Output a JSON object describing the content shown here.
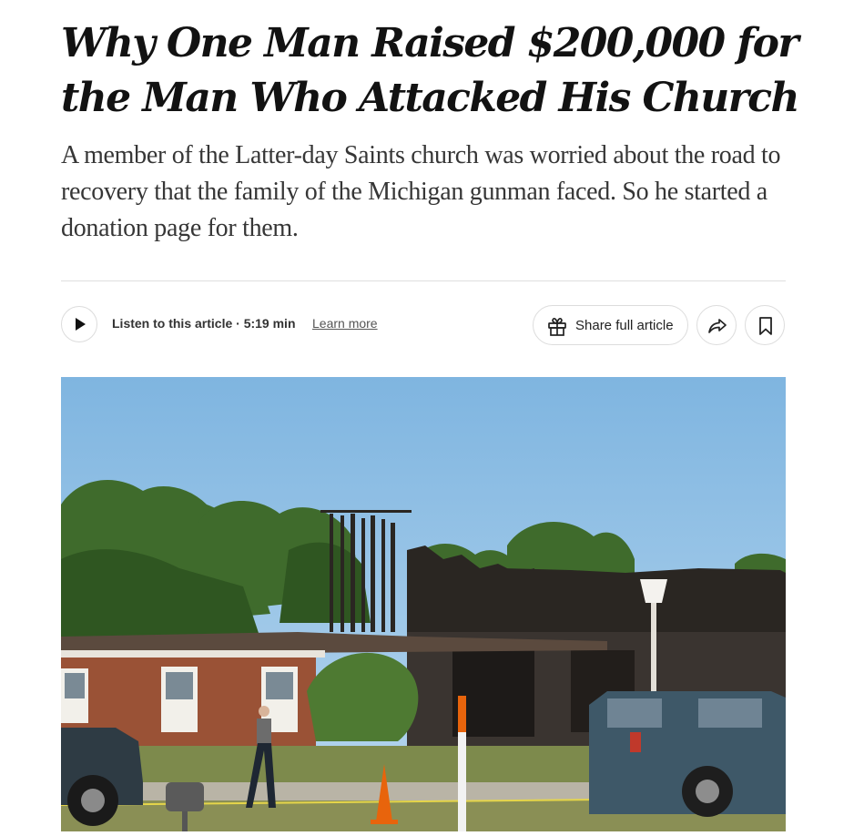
{
  "article": {
    "headline": "Why One Man Raised $200,000 for the Man Who Attacked His Church",
    "dek": "A member of the Latter-day Saints church was worried about the road to recovery that the family of the Michigan gunman faced. So he started a donation page for them."
  },
  "audio": {
    "listen_label": "Listen to this article · 5:19 min",
    "learn_more": "Learn more",
    "play_icon": "play-icon"
  },
  "actions": {
    "share_label": "Share full article",
    "gift_icon": "gift-icon",
    "forward_icon": "share-arrow-icon",
    "bookmark_icon": "bookmark-icon"
  },
  "photo": {
    "sky_color": "#8ebfe6",
    "cone_color": "#e8640c",
    "truck_color": "#3e5868"
  }
}
